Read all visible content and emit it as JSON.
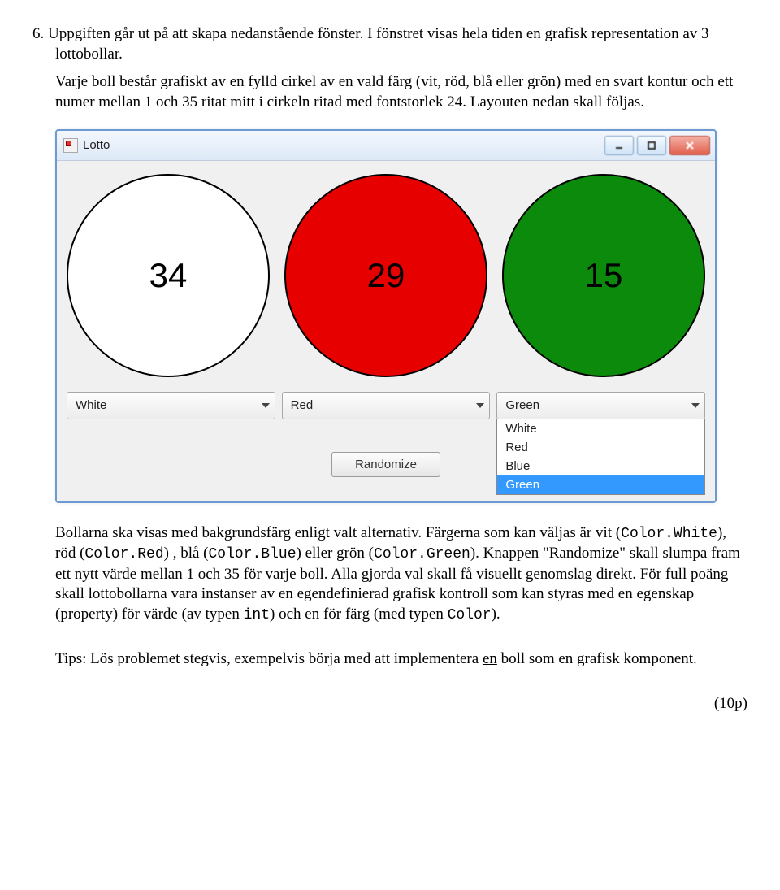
{
  "question_number": "6.",
  "intro_para": "Uppgiften går ut på att skapa nedanstående fönster. I fönstret visas hela tiden en grafisk representation av 3 lottobollar.",
  "description_para": "Varje boll består grafiskt av en fylld cirkel av en vald färg (vit, röd, blå eller grön) med en svart kontur och ett numer mellan 1 och 35 ritat mitt i cirkeln ritad med fontstorlek 24. Layouten nedan skall följas.",
  "window": {
    "title": "Lotto",
    "balls": [
      {
        "value": "34",
        "bg": "#ffffff"
      },
      {
        "value": "29",
        "bg": "#e60000"
      },
      {
        "value": "15",
        "bg": "#0b8a0b"
      }
    ],
    "combos": [
      {
        "selected": "White",
        "open": false
      },
      {
        "selected": "Red",
        "open": false
      },
      {
        "selected": "Green",
        "open": true
      }
    ],
    "options": [
      "White",
      "Red",
      "Blue",
      "Green"
    ],
    "randomize_label": "Randomize"
  },
  "below": {
    "p1_a": "Bollarna ska visas med bakgrundsfärg enligt valt alternativ. Färgerna som kan väljas är vit (",
    "c1": "Color.White",
    "p1_b": "), röd (",
    "c2": "Color.Red",
    "p1_c": ") , blå (",
    "c3": "Color.Blue",
    "p1_d": ") eller grön (",
    "c4": "Color.Green",
    "p1_e": "). Knappen \"Randomize\" skall slumpa fram ett nytt värde mellan 1 och 35 för varje boll. Alla gjorda val skall få visuellt genomslag direkt. För full poäng skall lottobollarna vara instanser av en egendefinierad grafisk kontroll som kan styras med en egenskap (property) för värde (av typen ",
    "c5": "int",
    "p1_f": ") och en för färg (med typen ",
    "c6": "Color",
    "p1_g": ")."
  },
  "tip_a": "Tips: Lös problemet stegvis, exempelvis börja med att implementera ",
  "tip_u": "en",
  "tip_b": " boll som en grafisk komponent.",
  "points": "(10p)"
}
